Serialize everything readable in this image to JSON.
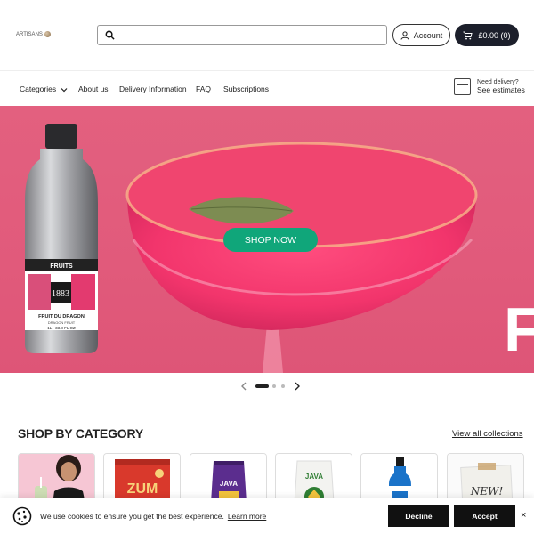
{
  "header": {
    "logo_text": "ARTISANS",
    "search": {
      "placeholder": "",
      "value": ""
    },
    "account_label": "Account",
    "cart_label": "£0.00 (0)"
  },
  "nav": {
    "items": [
      {
        "label": "Categories"
      },
      {
        "label": "About us"
      },
      {
        "label": "Delivery Information"
      },
      {
        "label": "FAQ"
      },
      {
        "label": "Subscriptions"
      }
    ],
    "delivery": {
      "line1": "Need delivery?",
      "line2": "See estimates"
    }
  },
  "hero": {
    "cta_label": "SHOP NOW",
    "bottle": {
      "line1": "FRUITS",
      "brand": "1883",
      "flavor": "FRUIT DU DRAGON",
      "sub": "DRAGON FRUIT",
      "volume": "1L - 33.8 FL OZ"
    },
    "big_letter": "F"
  },
  "carousel": {
    "slides": 3,
    "active": 1
  },
  "shop_by_category": {
    "title": "SHOP BY CATEGORY",
    "view_all_label": "View all collections",
    "cards": [
      {
        "icon": "drink-photo"
      },
      {
        "icon": "zuma-tin",
        "text": "ZUM"
      },
      {
        "icon": "java-bag",
        "text": "JAVA"
      },
      {
        "icon": "java-bag-white",
        "text": "JAVA"
      },
      {
        "icon": "syrup-bottle"
      },
      {
        "icon": "new-sign",
        "text": "NEW!"
      }
    ]
  },
  "cookie_bar": {
    "message": "We use cookies to ensure you get the best experience.",
    "learn_more_label": "Learn more",
    "decline_label": "Decline",
    "accept_label": "Accept",
    "close_label": "×"
  },
  "colors": {
    "hero_bg": "#e15a7b",
    "cta_green": "#10a67a",
    "dark": "#1c1f2b"
  }
}
